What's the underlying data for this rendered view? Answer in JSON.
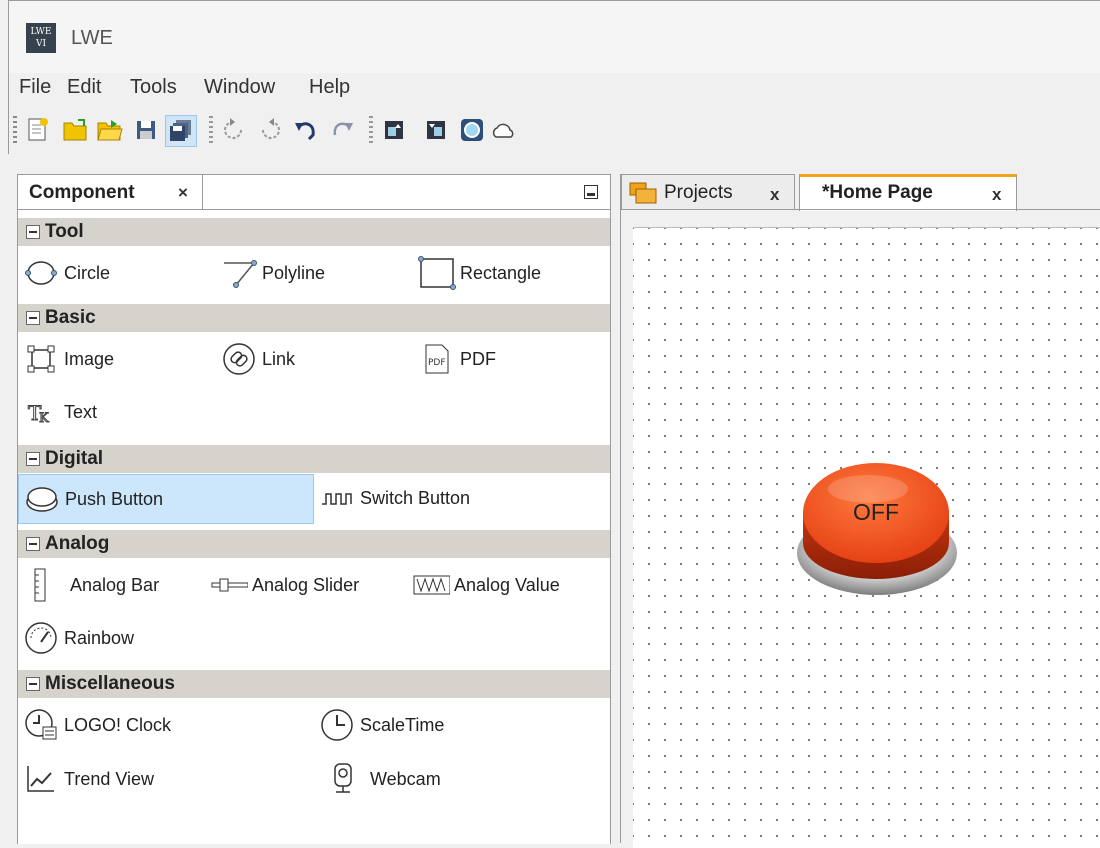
{
  "window": {
    "title": "LWE",
    "icon_text": "LWE VI"
  },
  "menu": [
    "File",
    "Edit",
    "Tools",
    "Window",
    "Help"
  ],
  "toolbar": {
    "icons": [
      "new-file-icon",
      "open-project-icon",
      "open-folder-icon",
      "save-icon",
      "save-all-icon",
      "rotate-left-icon",
      "rotate-right-icon",
      "undo-icon",
      "redo-icon",
      "upload-icon",
      "download-icon",
      "web-server-icon",
      "cloud-icon"
    ]
  },
  "component_panel": {
    "tab_label": "Component",
    "close": "×",
    "categories": [
      {
        "label": "Tool",
        "items": [
          {
            "label": "Circle",
            "icon": "circle-icon"
          },
          {
            "label": "Polyline",
            "icon": "polyline-icon"
          },
          {
            "label": "Rectangle",
            "icon": "rectangle-icon"
          }
        ]
      },
      {
        "label": "Basic",
        "items": [
          {
            "label": "Image",
            "icon": "image-icon"
          },
          {
            "label": "Link",
            "icon": "link-icon"
          },
          {
            "label": "PDF",
            "icon": "pdf-icon"
          },
          {
            "label": "Text",
            "icon": "text-icon"
          }
        ]
      },
      {
        "label": "Digital",
        "items": [
          {
            "label": "Push Button",
            "icon": "push-button-icon",
            "selected": true
          },
          {
            "label": "Switch Button",
            "icon": "switch-button-icon"
          }
        ]
      },
      {
        "label": "Analog",
        "items": [
          {
            "label": "Analog Bar",
            "icon": "analog-bar-icon"
          },
          {
            "label": "Analog Slider",
            "icon": "analog-slider-icon"
          },
          {
            "label": "Analog Value",
            "icon": "analog-value-icon"
          },
          {
            "label": "Rainbow",
            "icon": "rainbow-gauge-icon"
          }
        ]
      },
      {
        "label": "Miscellaneous",
        "items": [
          {
            "label": "LOGO! Clock",
            "icon": "logo-clock-icon"
          },
          {
            "label": "ScaleTime",
            "icon": "scale-time-icon"
          },
          {
            "label": "Trend View",
            "icon": "trend-view-icon"
          },
          {
            "label": "Webcam",
            "icon": "webcam-icon"
          }
        ]
      }
    ]
  },
  "doc_tabs": [
    {
      "label": "Projects",
      "close": "x",
      "active": false
    },
    {
      "label": "*Home Page",
      "close": "x",
      "active": true
    }
  ],
  "canvas": {
    "push_button": {
      "label": "OFF",
      "color": "#e84a1c"
    }
  }
}
